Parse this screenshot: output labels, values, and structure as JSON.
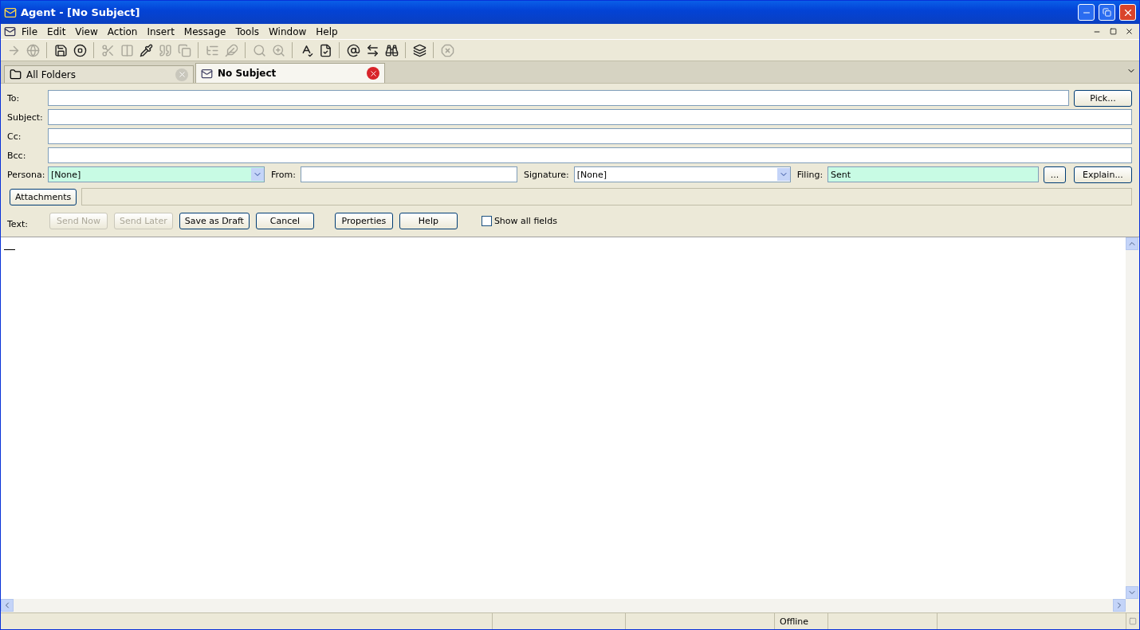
{
  "window": {
    "title": "Agent - [No Subject]"
  },
  "menu": [
    "File",
    "Edit",
    "View",
    "Action",
    "Insert",
    "Message",
    "Tools",
    "Window",
    "Help"
  ],
  "toolbar": [
    [
      {
        "disabled": true
      },
      {
        "disabled": true
      }
    ],
    [
      {
        "disabled": false
      },
      {
        "disabled": false
      }
    ],
    [
      {
        "disabled": true
      },
      {
        "disabled": true
      },
      {
        "disabled": false
      },
      {
        "disabled": true
      },
      {
        "disabled": true
      }
    ],
    [
      {
        "disabled": true
      },
      {
        "disabled": true
      }
    ],
    [
      {
        "disabled": true
      },
      {
        "disabled": true
      }
    ],
    [
      {
        "disabled": false
      },
      {
        "disabled": false
      }
    ],
    [
      {
        "disabled": false
      },
      {
        "disabled": false
      },
      {
        "disabled": false
      }
    ],
    [
      {
        "disabled": false
      }
    ],
    [
      {
        "disabled": true
      }
    ]
  ],
  "tabs": [
    {
      "label": "All Folders",
      "selected": false
    },
    {
      "label": "No Subject",
      "selected": true
    }
  ],
  "fields": [
    {
      "label": "To:",
      "button": "Pick..."
    },
    {
      "label": "Subject:"
    },
    {
      "label": "Cc:"
    },
    {
      "label": "Bcc:"
    }
  ],
  "options": {
    "persona": {
      "label": "Persona:",
      "value": "[None]"
    },
    "from": {
      "label": "From:"
    },
    "signature": {
      "label": "Signature:",
      "value": "[None]"
    },
    "filing": {
      "label": "Filing:",
      "value": "Sent"
    },
    "browse": "...",
    "explain": "Explain..."
  },
  "attachments": "Attachments",
  "text_label": "Text:",
  "actions": [
    {
      "label": "Send Now",
      "disabled": true
    },
    {
      "label": "Send Later",
      "disabled": true
    },
    {
      "label": "Save as Draft",
      "disabled": false
    },
    {
      "label": "Cancel",
      "disabled": false
    },
    {
      "label": "Properties",
      "disabled": false
    },
    {
      "label": "Help",
      "disabled": false
    }
  ],
  "show_all": {
    "label": "Show all fields",
    "checked": false
  },
  "status_bar": {
    "connection": "Offline"
  }
}
